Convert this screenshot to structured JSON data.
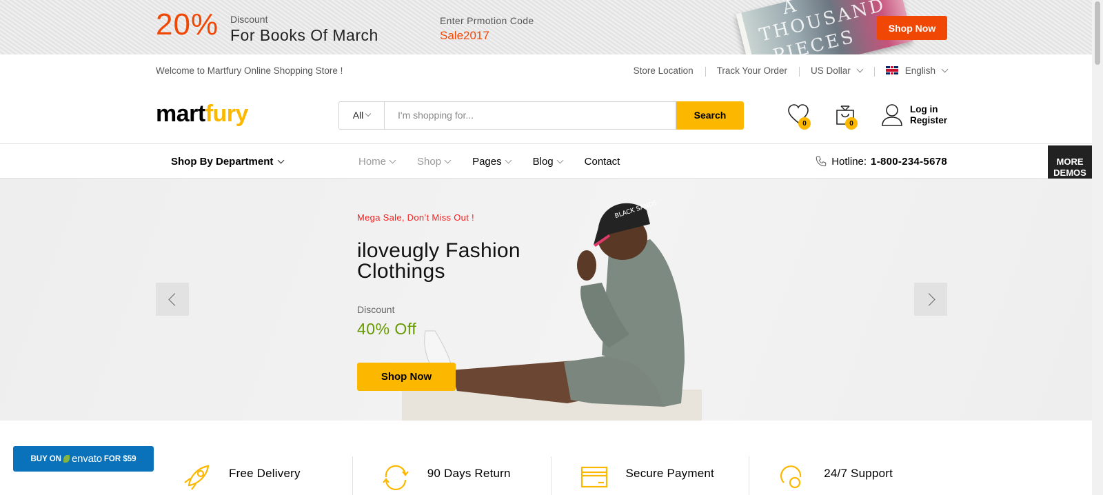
{
  "promo": {
    "percent": "20%",
    "subtitle": "Discount",
    "title": "For Books Of March",
    "code_label": "Enter Prmotion Code",
    "code": "Sale2017",
    "book_words": [
      "A",
      "THOUSAND",
      "PIECES"
    ],
    "button": "Shop Now"
  },
  "topbar": {
    "welcome": "Welcome to Martfury Online Shopping Store !",
    "links": [
      "Store Location",
      "Track Your Order"
    ],
    "currency": "US Dollar",
    "language": "English"
  },
  "header": {
    "logo_part1": "mart",
    "logo_part2": "fury",
    "search": {
      "category": "All",
      "placeholder": "I'm shopping for...",
      "button": "Search"
    },
    "wishlist_count": "0",
    "cart_count": "0",
    "login": "Log in",
    "register": "Register"
  },
  "nav": {
    "department": "Shop By Department",
    "items": [
      {
        "label": "Home",
        "dropdown": true
      },
      {
        "label": "Shop",
        "dropdown": true
      },
      {
        "label": "Pages",
        "dropdown": true
      },
      {
        "label": "Blog",
        "dropdown": true
      },
      {
        "label": "Contact",
        "dropdown": false
      }
    ],
    "hotline_label": "Hotline:",
    "hotline_number": "1-800-234-5678",
    "more_demos": "MORE DEMOS"
  },
  "hero": {
    "tag": "Mega Sale, Don’t Miss Out !",
    "title": "iloveugly Fashion Clothings",
    "discount_label": "Discount",
    "discount_value": "40% Off",
    "button": "Shop Now",
    "cap_text": "BLACK SANDS"
  },
  "features": [
    {
      "icon": "rocket-icon",
      "title": "Free Delivery"
    },
    {
      "icon": "refresh-icon",
      "title": "90 Days Return"
    },
    {
      "icon": "credit-card-icon",
      "title": "Secure Payment"
    },
    {
      "icon": "support-icon",
      "title": "24/7 Support"
    }
  ],
  "envato": {
    "prefix": "BUY ON",
    "brand": "envato",
    "suffix": "FOR $59"
  },
  "colors": {
    "accent": "#fcb800",
    "promo_orange": "#f14705",
    "sale_red": "#f61f1f",
    "discount_green": "#669900",
    "envato_blue": "#0a72bb"
  }
}
